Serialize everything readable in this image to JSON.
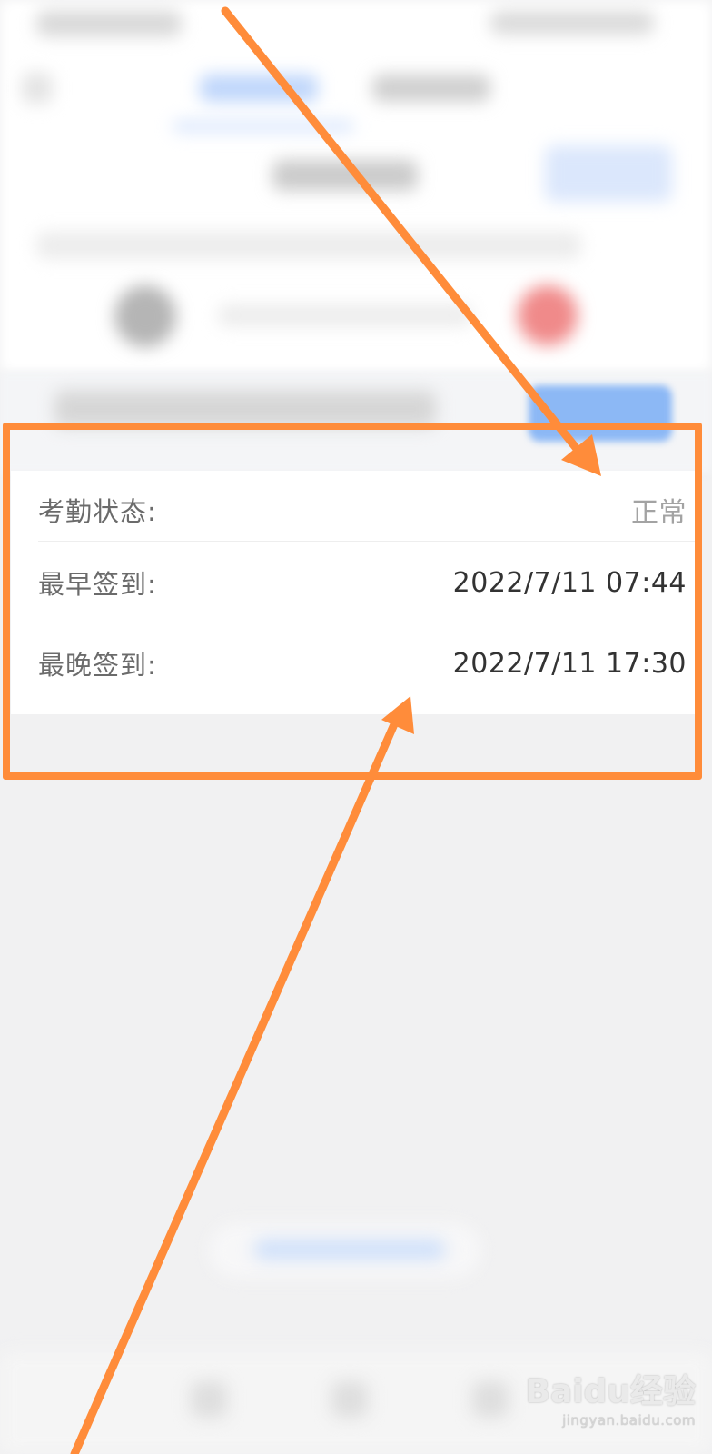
{
  "attendance_detail": {
    "status": {
      "label": "考勤状态:",
      "value": "正常"
    },
    "earliest_checkin": {
      "label": "最早签到:",
      "value": "2022/7/11 07:44"
    },
    "latest_checkin": {
      "label": "最晚签到:",
      "value": "2022/7/11 17:30"
    }
  },
  "watermark": {
    "brand": "Baidu经验",
    "url": "jingyan.baidu.com"
  },
  "colors": {
    "annotation": "#ff8c3a",
    "accent_blue": "#8cb8f5",
    "badge_red": "#f08a8a"
  }
}
